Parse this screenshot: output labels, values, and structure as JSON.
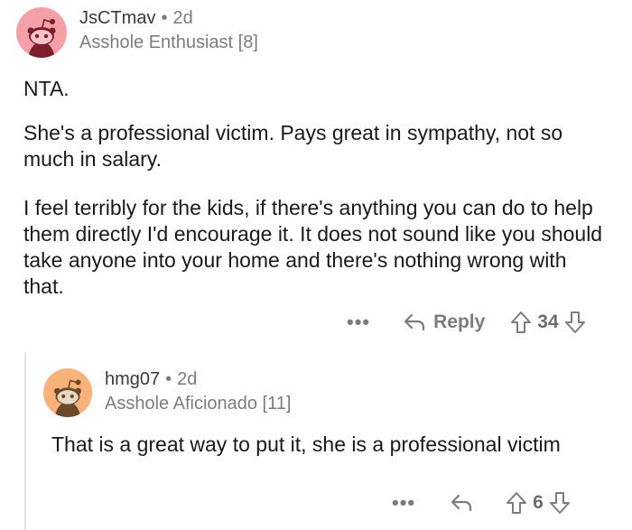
{
  "comments": [
    {
      "username": "JsCTmav",
      "separator": "•",
      "age": "2d",
      "flair": "Asshole Enthusiast [8]",
      "paragraphs": [
        "NTA.",
        "She's a professional victim. Pays great in sympathy, not so much in salary.",
        "I feel terribly for the kids, if there's anything you can do to help them directly I'd encourage it. It does not sound like you should take anyone into your home and there's nothing wrong with that."
      ],
      "actions": {
        "more_label": "•••",
        "reply_label": "Reply",
        "score": "34"
      },
      "avatar_color": "#f4a0a6"
    },
    {
      "username": "hmg07",
      "separator": "•",
      "age": "2d",
      "flair": "Asshole Aficionado [11]",
      "paragraphs": [
        "That is a great way to put it, she is a professional victim"
      ],
      "actions": {
        "more_label": "•••",
        "score": "6"
      },
      "avatar_color": "#f8b27a"
    }
  ],
  "icons": {
    "reply": "reply-arrow-icon",
    "upvote": "upvote-arrow-icon",
    "downvote": "downvote-arrow-icon",
    "more": "more-options-icon"
  }
}
